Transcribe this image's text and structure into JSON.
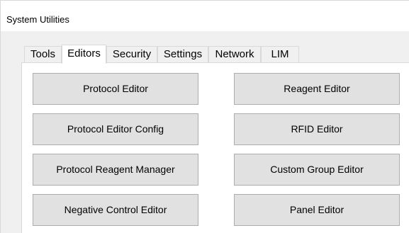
{
  "window": {
    "title": "System Utilities"
  },
  "tabs": [
    {
      "label": "Tools",
      "active": false
    },
    {
      "label": "Editors",
      "active": true
    },
    {
      "label": "Security",
      "active": false
    },
    {
      "label": "Settings",
      "active": false
    },
    {
      "label": "Network",
      "active": false
    },
    {
      "label": "LIM",
      "active": false
    }
  ],
  "editors_panel": {
    "left_buttons": [
      "Protocol Editor",
      "Protocol Editor Config",
      "Protocol Reagent Manager",
      "Negative Control Editor"
    ],
    "right_buttons": [
      "Reagent Editor",
      "RFID Editor",
      "Custom Group Editor",
      "Panel Editor"
    ]
  }
}
